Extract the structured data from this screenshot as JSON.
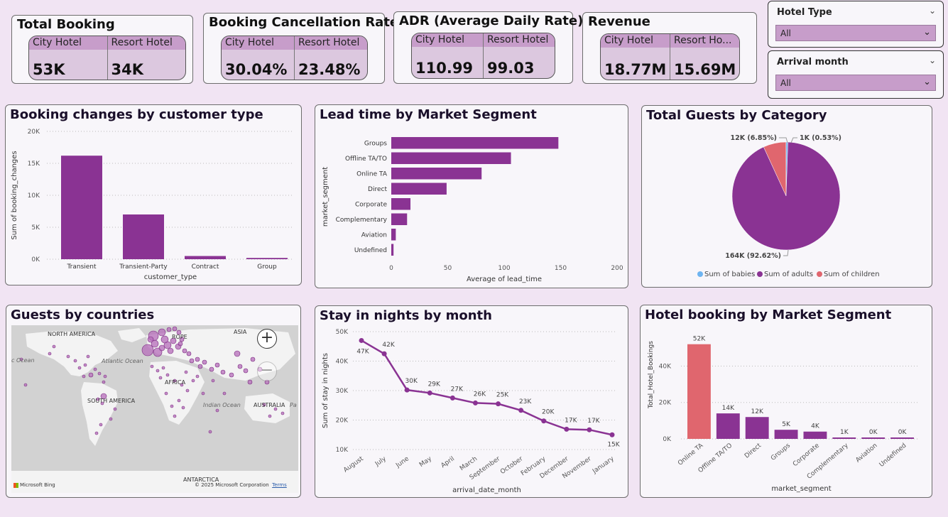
{
  "kpis": {
    "total_booking": {
      "title": "Total Booking",
      "col1": "City Hotel",
      "col2": "Resort Hotel",
      "val1": "53K",
      "val2": "34K"
    },
    "cancellation": {
      "title": "Booking Cancellation Rate",
      "col1": "City Hotel",
      "col2": "Resort Hotel",
      "val1": "30.04%",
      "val2": "23.48%"
    },
    "adr": {
      "title": "ADR (Average Daily Rate)",
      "col1": "City Hotel",
      "col2": "Resort Hotel",
      "val1": "110.99",
      "val2": "99.03"
    },
    "revenue": {
      "title": "Revenue",
      "col1": "City Hotel",
      "col2": "Resort Ho...",
      "val1": "18.77M",
      "val2": "15.69M"
    }
  },
  "slicers": {
    "hotel_type": {
      "title": "Hotel Type",
      "value": "All"
    },
    "arrival_month": {
      "title": "Arrival month",
      "value": "All"
    }
  },
  "icons": {
    "chevron": "chevron-down-icon",
    "zoom_in": "plus-icon",
    "zoom_out": "minus-icon"
  },
  "colors": {
    "purple": "#8a3393",
    "salmon": "#e0666e",
    "blue": "#6eb4f0",
    "bg": "#f1e4f3"
  },
  "map": {
    "title": "Guests by countries",
    "labels": {
      "north_america": "NORTH AMERICA",
      "europe": "ROPE",
      "asia": "ASIA",
      "africa": "AFRICA",
      "south_america": "SOUTH AMERICA",
      "australia": "AUSTRALIA",
      "antarctica": "ANTARCTICA"
    },
    "oceans": {
      "atlantic": "Atlantic Ocean",
      "indian": "Indian Ocean",
      "left": "c Ocean",
      "right": "Pa"
    },
    "attribution": "Microsoft Bing",
    "copyright": "© 2025 Microsoft Corporation",
    "terms": "Terms"
  },
  "chart_data": [
    {
      "id": "booking_changes",
      "type": "bar",
      "title": "Booking changes by customer type",
      "xlabel": "customer_type",
      "ylabel": "Sum of booking_changes",
      "categories": [
        "Transient",
        "Transient-Party",
        "Contract",
        "Group"
      ],
      "values": [
        16200,
        7000,
        500,
        200
      ],
      "ylim": [
        0,
        20000
      ],
      "yticks": [
        0,
        5000,
        10000,
        15000,
        20000
      ],
      "ytick_labels": [
        "0K",
        "5K",
        "10K",
        "15K",
        "20K"
      ],
      "grid": true
    },
    {
      "id": "lead_time",
      "type": "bar",
      "orientation": "horizontal",
      "title": "Lead time by Market Segment",
      "xlabel": "Average of lead_time",
      "ylabel": "market_segment",
      "categories": [
        "Groups",
        "Offline TA/TO",
        "Online TA",
        "Direct",
        "Corporate",
        "Complementary",
        "Aviation",
        "Undefined"
      ],
      "values": [
        148,
        106,
        80,
        49,
        17,
        14,
        4,
        2
      ],
      "xlim": [
        0,
        200
      ],
      "xticks": [
        0,
        50,
        100,
        150,
        200
      ]
    },
    {
      "id": "guests_category",
      "type": "pie",
      "title": "Total Guests by Category",
      "labels": [
        "Sum of babies",
        "Sum of adults",
        "Sum of children"
      ],
      "values": [
        0.53,
        92.62,
        6.85
      ],
      "data_labels": [
        "1K (0.53%)",
        "164K (92.62%)",
        "12K (6.85%)"
      ],
      "legend_position": "bottom"
    },
    {
      "id": "stay_nights",
      "type": "line",
      "title": "Stay in nights by month",
      "xlabel": "arrival_date_month",
      "ylabel": "Sum of stay in nights",
      "x": [
        "August",
        "July",
        "June",
        "May",
        "April",
        "March",
        "September",
        "October",
        "February",
        "December",
        "November",
        "January"
      ],
      "values": [
        47000,
        42500,
        30200,
        29200,
        27500,
        25800,
        25500,
        23300,
        19700,
        16900,
        16700,
        15000
      ],
      "data_labels": [
        "47K",
        "42K",
        "30K",
        "29K",
        "27K",
        "26K",
        "25K",
        "23K",
        "20K",
        "17K",
        "17K",
        "15K"
      ],
      "ylim": [
        10000,
        50000
      ],
      "yticks": [
        10000,
        20000,
        30000,
        40000,
        50000
      ],
      "ytick_labels": [
        "10K",
        "20K",
        "30K",
        "40K",
        "50K"
      ],
      "grid": true
    },
    {
      "id": "hotel_booking_segment",
      "type": "bar",
      "title": "Hotel booking by Market Segment",
      "xlabel": "market_segment",
      "ylabel": "Total_Hotel_Bookings",
      "categories": [
        "Online TA",
        "Offline TA/TO",
        "Direct",
        "Groups",
        "Corporate",
        "Complementary",
        "Aviation",
        "Undefined"
      ],
      "values": [
        52000,
        14000,
        12000,
        5000,
        4000,
        700,
        200,
        10
      ],
      "data_labels": [
        "52K",
        "14K",
        "12K",
        "5K",
        "4K",
        "1K",
        "0K",
        "0K"
      ],
      "ylim": [
        0,
        55000
      ],
      "yticks": [
        0,
        20000,
        40000
      ],
      "ytick_labels": [
        "0K",
        "20K",
        "40K"
      ],
      "grid": true
    }
  ]
}
